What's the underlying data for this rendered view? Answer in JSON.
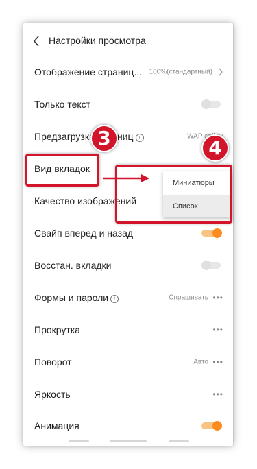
{
  "header": {
    "title": "Настройки просмотра"
  },
  "rows": [
    {
      "label": "Отображение страниц...",
      "value": "100%(стандартный)"
    },
    {
      "label": "Только текст"
    },
    {
      "label": "Предзагрузка страниц",
      "value": "WAP сайты"
    },
    {
      "label": "Вид вкладок"
    },
    {
      "label": "Качество изображений"
    },
    {
      "label": "Свайп вперед и назад"
    },
    {
      "label": "Восстан. вкладки"
    },
    {
      "label": "Формы и пароли",
      "value": "Спрашивать"
    },
    {
      "label": "Прокрутка"
    },
    {
      "label": "Поворот",
      "value": "Авто"
    },
    {
      "label": "Яркость"
    },
    {
      "label": "Анимация"
    }
  ],
  "toggles": {
    "text_only": false,
    "swipe": true,
    "restore_tabs": false,
    "animation": true
  },
  "dropdown": {
    "options": [
      "Миниатюры",
      "Список"
    ],
    "selected": "Список"
  },
  "annotations": {
    "step_a": "3",
    "step_b": "4"
  },
  "colors": {
    "accent": "#ff8a1f",
    "annotation": "#d2152b"
  }
}
